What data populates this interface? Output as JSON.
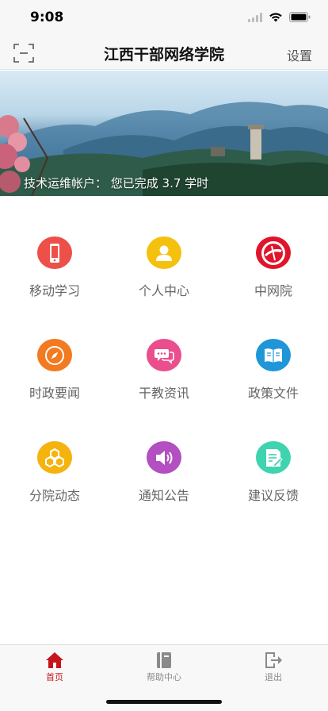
{
  "status_bar": {
    "time": "9:08"
  },
  "nav": {
    "title": "江西干部网络学院",
    "settings_label": "设置",
    "scan_icon": "scan-icon"
  },
  "banner": {
    "caption": "技术运维帐户：  您已完成 3.7 学时"
  },
  "grid": [
    {
      "label": "移动学习",
      "icon": "phone-icon",
      "color": "#ec5048"
    },
    {
      "label": "个人中心",
      "icon": "person-icon",
      "color": "#f4c10f"
    },
    {
      "label": "中网院",
      "icon": "logo-icon",
      "color": "#e0142a"
    },
    {
      "label": "时政要闻",
      "icon": "compass-icon",
      "color": "#f27a20"
    },
    {
      "label": "干教资讯",
      "icon": "chat-icon",
      "color": "#ea4e8c"
    },
    {
      "label": "政策文件",
      "icon": "book-icon",
      "color": "#1f96d8"
    },
    {
      "label": "分院动态",
      "icon": "hexagons-icon",
      "color": "#f5b30d"
    },
    {
      "label": "通知公告",
      "icon": "speaker-icon",
      "color": "#b34fc0"
    },
    {
      "label": "建议反馈",
      "icon": "feedback-icon",
      "color": "#3fd3b0"
    }
  ],
  "tabs": [
    {
      "label": "首页",
      "icon": "home-icon",
      "active": true
    },
    {
      "label": "帮助中心",
      "icon": "help-book-icon",
      "active": false
    },
    {
      "label": "退出",
      "icon": "logout-icon",
      "active": false
    }
  ],
  "colors": {
    "accent": "#c4161c",
    "tab_inactive": "#8a8a8a"
  }
}
